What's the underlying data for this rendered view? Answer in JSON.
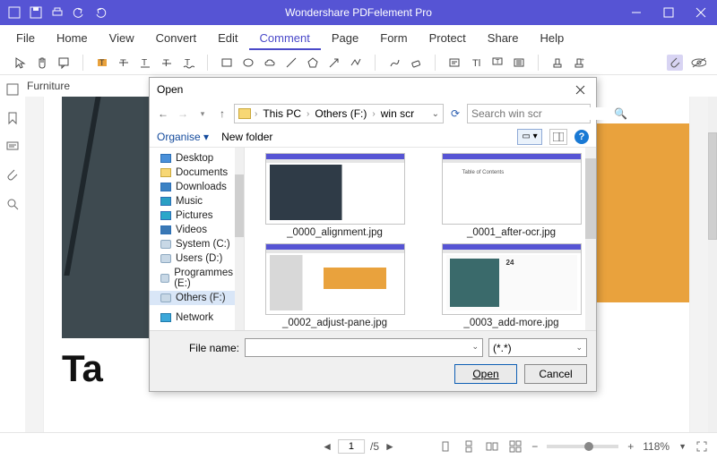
{
  "titlebar": {
    "app_title": "Wondershare PDFelement Pro"
  },
  "menu": {
    "items": [
      "File",
      "Home",
      "View",
      "Convert",
      "Edit",
      "Comment",
      "Page",
      "Form",
      "Protect",
      "Share",
      "Help"
    ],
    "active_index": 5
  },
  "breadcrumb": {
    "doc": "Furniture"
  },
  "page_preview": {
    "big_text": "Ta"
  },
  "status": {
    "current_page": "1",
    "total_pages": "/5",
    "zoom": "118%"
  },
  "dialog": {
    "title": "Open",
    "path": {
      "root": "This PC",
      "folder": "Others (F:)",
      "sub": "win scr"
    },
    "search": {
      "placeholder": "Search win scr"
    },
    "toolbar": {
      "organise": "Organise ▾",
      "newfolder": "New folder"
    },
    "tree": [
      "Desktop",
      "Documents",
      "Downloads",
      "Music",
      "Pictures",
      "Videos",
      "System (C:)",
      "Users (D:)",
      "Programmes (E:)",
      "Others (F:)",
      "Network"
    ],
    "tree_selected_index": 9,
    "files": [
      "_0000_alignment.jpg",
      "_0001_after-ocr.jpg",
      "_0002_adjust-pane.jpg",
      "_0003_add-more.jpg"
    ],
    "footer": {
      "filename_label": "File name:",
      "filter": "(*.*)",
      "open": "Open",
      "cancel": "Cancel"
    }
  }
}
